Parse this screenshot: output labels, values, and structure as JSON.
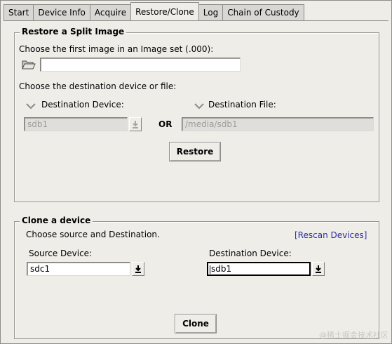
{
  "tabs": [
    {
      "label": "Start"
    },
    {
      "label": "Device Info"
    },
    {
      "label": "Acquire"
    },
    {
      "label": "Restore/Clone",
      "active": true
    },
    {
      "label": "Log"
    },
    {
      "label": "Chain of Custody"
    }
  ],
  "restore": {
    "title": "Restore a Split Image",
    "choose_image_label": "Choose the first image in an Image set (.000):",
    "image_path_value": "",
    "choose_dest_label": "Choose the destination device or file:",
    "dest_device_option": "Destination Device:",
    "dest_file_option": "Destination File:",
    "dest_device_value": "sdb1",
    "or_label": "OR",
    "dest_file_value": "/media/sdb1",
    "restore_button": "Restore"
  },
  "clone": {
    "title": "Clone a device",
    "choose_label": "Choose source and Destination.",
    "rescan_link": "[Rescan Devices]",
    "source_label": "Source Device:",
    "source_value": "sdc1",
    "dest_label": "Destination Device:",
    "dest_value": "sdb1",
    "clone_button": "Clone"
  },
  "watermark": "@稀土掘金技术社区",
  "colors": {
    "background": "#efede8",
    "link": "#2c2ca8",
    "disabled_field": "#e0dedb"
  },
  "icons": {
    "folder": "folder-open-icon",
    "download_arrow": "download-arrow-icon",
    "radio_indicator": "chevron-down-icon"
  }
}
